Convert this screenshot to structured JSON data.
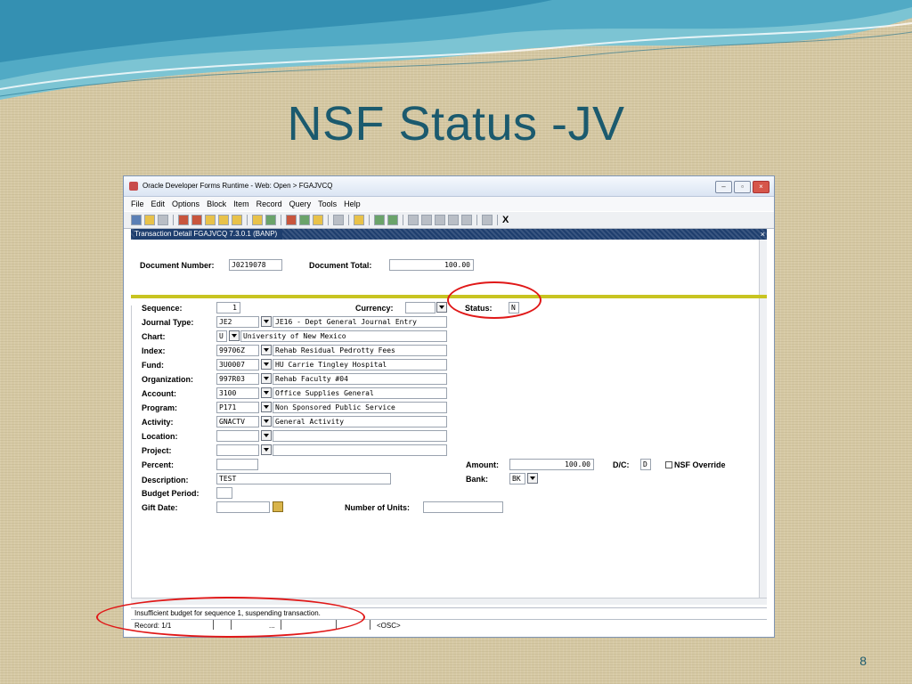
{
  "slide": {
    "title": "NSF Status -JV",
    "page_number": "8"
  },
  "window": {
    "title": "Oracle Developer Forms Runtime - Web:  Open > FGAJVCQ",
    "controls": [
      "minimize",
      "maximize",
      "close"
    ]
  },
  "menu": [
    "File",
    "Edit",
    "Options",
    "Block",
    "Item",
    "Record",
    "Query",
    "Tools",
    "Help"
  ],
  "form": {
    "title": "Transaction Detail  FGAJVCQ  7.3.0.1  (BANP)",
    "header": {
      "document_number_label": "Document Number:",
      "document_number": "J0219078",
      "document_total_label": "Document Total:",
      "document_total": "100.00"
    },
    "labels": {
      "sequence": "Sequence:",
      "journal_type": "Journal Type:",
      "chart": "Chart:",
      "index": "Index:",
      "fund": "Fund:",
      "organization": "Organization:",
      "account": "Account:",
      "program": "Program:",
      "activity": "Activity:",
      "location": "Location:",
      "project": "Project:",
      "percent": "Percent:",
      "description": "Description:",
      "budget_period": "Budget Period:",
      "gift_date": "Gift Date:",
      "currency": "Currency:",
      "status": "Status:",
      "amount": "Amount:",
      "bank": "Bank:",
      "dc": "D/C:",
      "nsf_override": "NSF Override",
      "number_of_units": "Number of Units:"
    },
    "values": {
      "sequence": "1",
      "journal_type_code": "JE2",
      "journal_type_desc": "JE16 - Dept General Journal Entry",
      "chart_code": "U",
      "chart_desc": "University of New Mexico",
      "index_code": "99706Z",
      "index_desc": "Rehab Residual Pedrotty Fees",
      "fund_code": "3U0007",
      "fund_desc": "HU Carrie Tingley Hospital",
      "org_code": "997R03",
      "org_desc": "Rehab Faculty #04",
      "account_code": "3100",
      "account_desc": "Office Supplies General",
      "program_code": "P171",
      "program_desc": "Non Sponsored Public Service",
      "activity_code": "GNACTV",
      "activity_desc": "General Activity",
      "location_code": "",
      "location_desc": "",
      "project_code": "",
      "project_desc": "",
      "percent": "",
      "description": "TEST",
      "budget_period": "",
      "gift_date": "",
      "currency": "",
      "status": "N",
      "amount": "100.00",
      "bank": "BK",
      "dc": "D",
      "number_of_units": ""
    }
  },
  "status": {
    "message": "Insufficient budget for sequence 1, suspending transaction.",
    "record": "Record: 1/1",
    "dots": "...",
    "osc": "<OSC>"
  },
  "colors": {
    "slide_title": "#1b5a6e",
    "form_bar": "#1e3e6e",
    "divider": "#c8c421",
    "highlight_ring": "#e01818"
  }
}
